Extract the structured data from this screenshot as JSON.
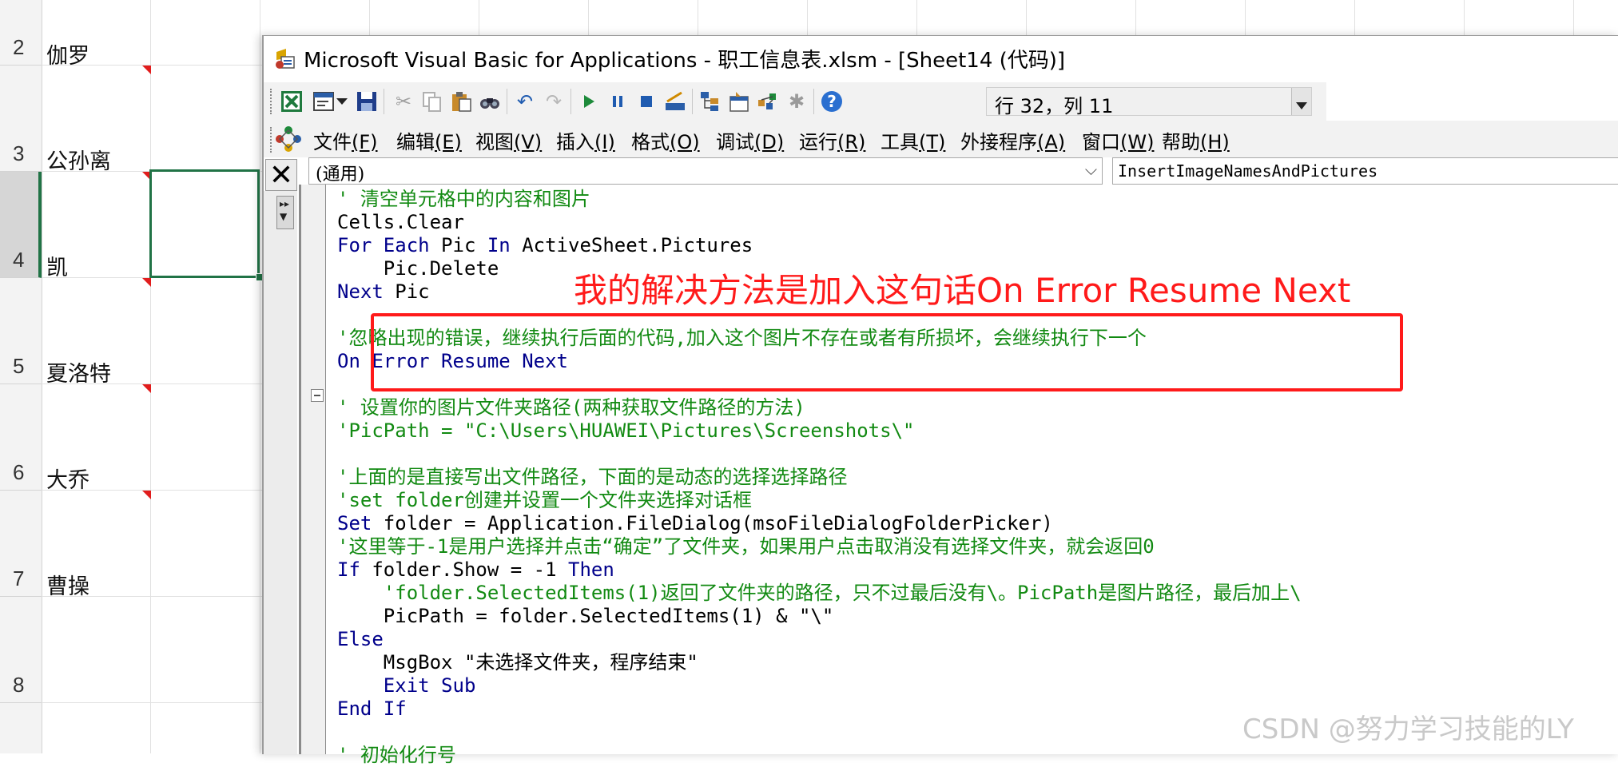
{
  "excel": {
    "rows": [
      {
        "number": "2",
        "name": "伽罗"
      },
      {
        "number": "3",
        "name": "公孙离"
      },
      {
        "number": "4",
        "name": "凯"
      },
      {
        "number": "5",
        "name": "夏洛特"
      },
      {
        "number": "6",
        "name": "大乔"
      },
      {
        "number": "7",
        "name": "曹操"
      },
      {
        "number": "8",
        "name": ""
      }
    ],
    "selected_row": "4"
  },
  "vba": {
    "title": "Microsoft Visual Basic for Applications - 职工信息表.xlsm - [Sheet14 (代码)]",
    "position": "行 32，列 11",
    "menu": [
      {
        "label": "文件",
        "key": "(F)"
      },
      {
        "label": "编辑",
        "key": "(E)"
      },
      {
        "label": "视图",
        "key": "(V)"
      },
      {
        "label": "插入",
        "key": "(I)"
      },
      {
        "label": "格式",
        "key": "(O)"
      },
      {
        "label": "调试",
        "key": "(D)"
      },
      {
        "label": "运行",
        "key": "(R)"
      },
      {
        "label": "工具",
        "key": "(T)"
      },
      {
        "label": "外接程序",
        "key": "(A)"
      },
      {
        "label": "窗口",
        "key": "(W)"
      },
      {
        "label": "帮助",
        "key": "(H)"
      }
    ],
    "object_combo": "(通用)",
    "procedure_combo": "InsertImageNamesAndPictures",
    "close_glyph": "✕",
    "code": {
      "l1": "' 清空单元格中的内容和图片",
      "l2": "Cells.Clear",
      "l3a": "For Each",
      "l3b": " Pic ",
      "l3c": "In",
      "l3d": " ActiveSheet.Pictures",
      "l4": "    Pic.Delete",
      "l5a": "Next",
      "l5b": " Pic",
      "l6": "'忽略出现的错误，继续执行后面的代码,加入这个图片不存在或者有所损坏，会继续执行下一个",
      "l7": "On Error Resume Next",
      "l8": "' 设置你的图片文件夹路径(两种获取文件路径的方法)",
      "l9": "'PicPath = \"C:\\Users\\HUAWEI\\Pictures\\Screenshots\\\"",
      "l10": "'上面的是直接写出文件路径，下面的是动态的选择选择路径",
      "l11": "'set folder创建并设置一个文件夹选择对话框",
      "l12a": "Set",
      "l12b": " folder = Application.FileDialog(msoFileDialogFolderPicker)",
      "l13": "'这里等于-1是用户选择并点击“确定”了文件夹，如果用户点击取消没有选择文件夹，就会返回0",
      "l14a": "If",
      "l14b": " folder.Show = -1 ",
      "l14c": "Then",
      "l15": "    'folder.SelectedItems(1)返回了文件夹的路径，只不过最后没有\\。PicPath是图片路径，最后加上\\",
      "l16": "    PicPath = folder.SelectedItems(1) & \"\\\"",
      "l17": "Else",
      "l18": "    MsgBox \"未选择文件夹，程序结束\"",
      "l19": "    Exit Sub",
      "l20": "End If",
      "l21": "' 初始化行号"
    }
  },
  "annotation": "我的解决方法是加入这句话On Error Resume Next",
  "watermark": "CSDN @努力学习技能的LY",
  "colors": {
    "keyword": "#00008b",
    "comment": "#128a12",
    "annotation": "#ff1a1a",
    "excel_green": "#217346",
    "comment_marker": "#e11d1d"
  }
}
